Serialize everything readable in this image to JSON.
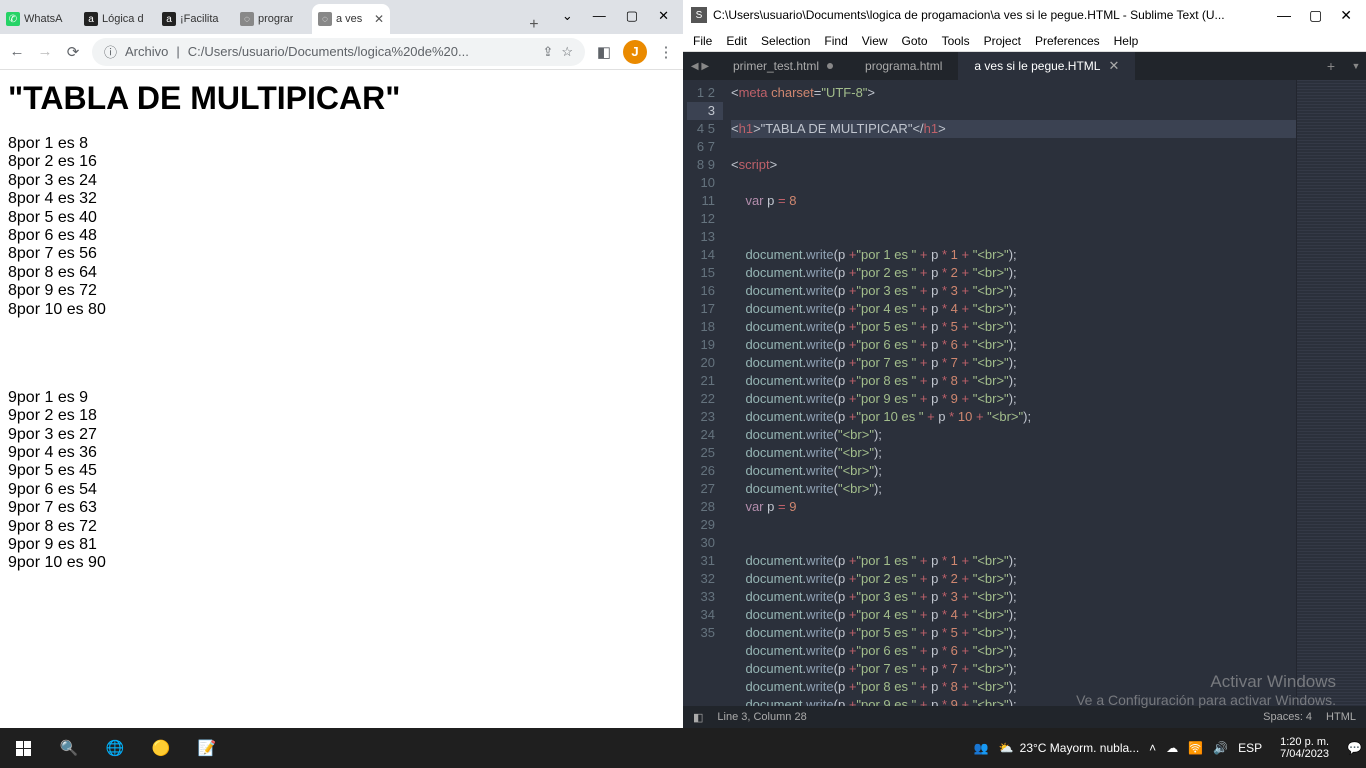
{
  "chrome": {
    "tabs": [
      {
        "title": "WhatsA",
        "favicon_bg": "#25d366",
        "favicon_char": "✆"
      },
      {
        "title": "Lógica d",
        "favicon_bg": "#222",
        "favicon_char": "a"
      },
      {
        "title": "¡Facilita",
        "favicon_bg": "#222",
        "favicon_char": "a"
      },
      {
        "title": "prograr",
        "favicon_bg": "#888",
        "favicon_char": "◌"
      },
      {
        "title": "a ves",
        "favicon_bg": "#888",
        "favicon_char": "◌",
        "active": true
      }
    ],
    "win": {
      "down": "⌄",
      "min": "—",
      "max": "▢",
      "close": "✕"
    },
    "toolbar": {
      "arch_label": "Archivo",
      "url": "C:/Users/usuario/Documents/logica%20de%20...",
      "avatar": "J"
    },
    "page": {
      "h1": "\"TABLA DE MULTIPICAR\"",
      "block1": [
        "8por 1 es 8",
        "8por 2 es 16",
        "8por 3 es 24",
        "8por 4 es 32",
        "8por 5 es 40",
        "8por 6 es 48",
        "8por 7 es 56",
        "8por 8 es 64",
        "8por 9 es 72",
        "8por 10 es 80"
      ],
      "block2": [
        "9por 1 es 9",
        "9por 2 es 18",
        "9por 3 es 27",
        "9por 4 es 36",
        "9por 5 es 45",
        "9por 6 es 54",
        "9por 7 es 63",
        "9por 8 es 72",
        "9por 9 es 81",
        "9por 10 es 90"
      ]
    }
  },
  "sublime": {
    "title": "C:\\Users\\usuario\\Documents\\logica de progamacion\\a ves si le pegue.HTML - Sublime Text (U...",
    "menu": [
      "File",
      "Edit",
      "Selection",
      "Find",
      "View",
      "Goto",
      "Tools",
      "Project",
      "Preferences",
      "Help"
    ],
    "tabs": [
      {
        "name": "primer_test.html",
        "dirty": true
      },
      {
        "name": "programa.html",
        "dirty": false
      },
      {
        "name": "a ves si le pegue.HTML",
        "dirty": false,
        "active": true
      }
    ],
    "status": {
      "pos": "Line 3, Column 28",
      "spaces": "Spaces: 4",
      "lang": "HTML"
    },
    "code_lines": 35,
    "highlighted_line": 3
  },
  "watermark": {
    "t1": "Activar Windows",
    "t2": "Ve a Configuración para activar Windows."
  },
  "taskbar": {
    "weather": "23°C  Mayorm. nubla...",
    "lang": "ESP",
    "time": "1:20 p. m.",
    "date": "7/04/2023"
  }
}
